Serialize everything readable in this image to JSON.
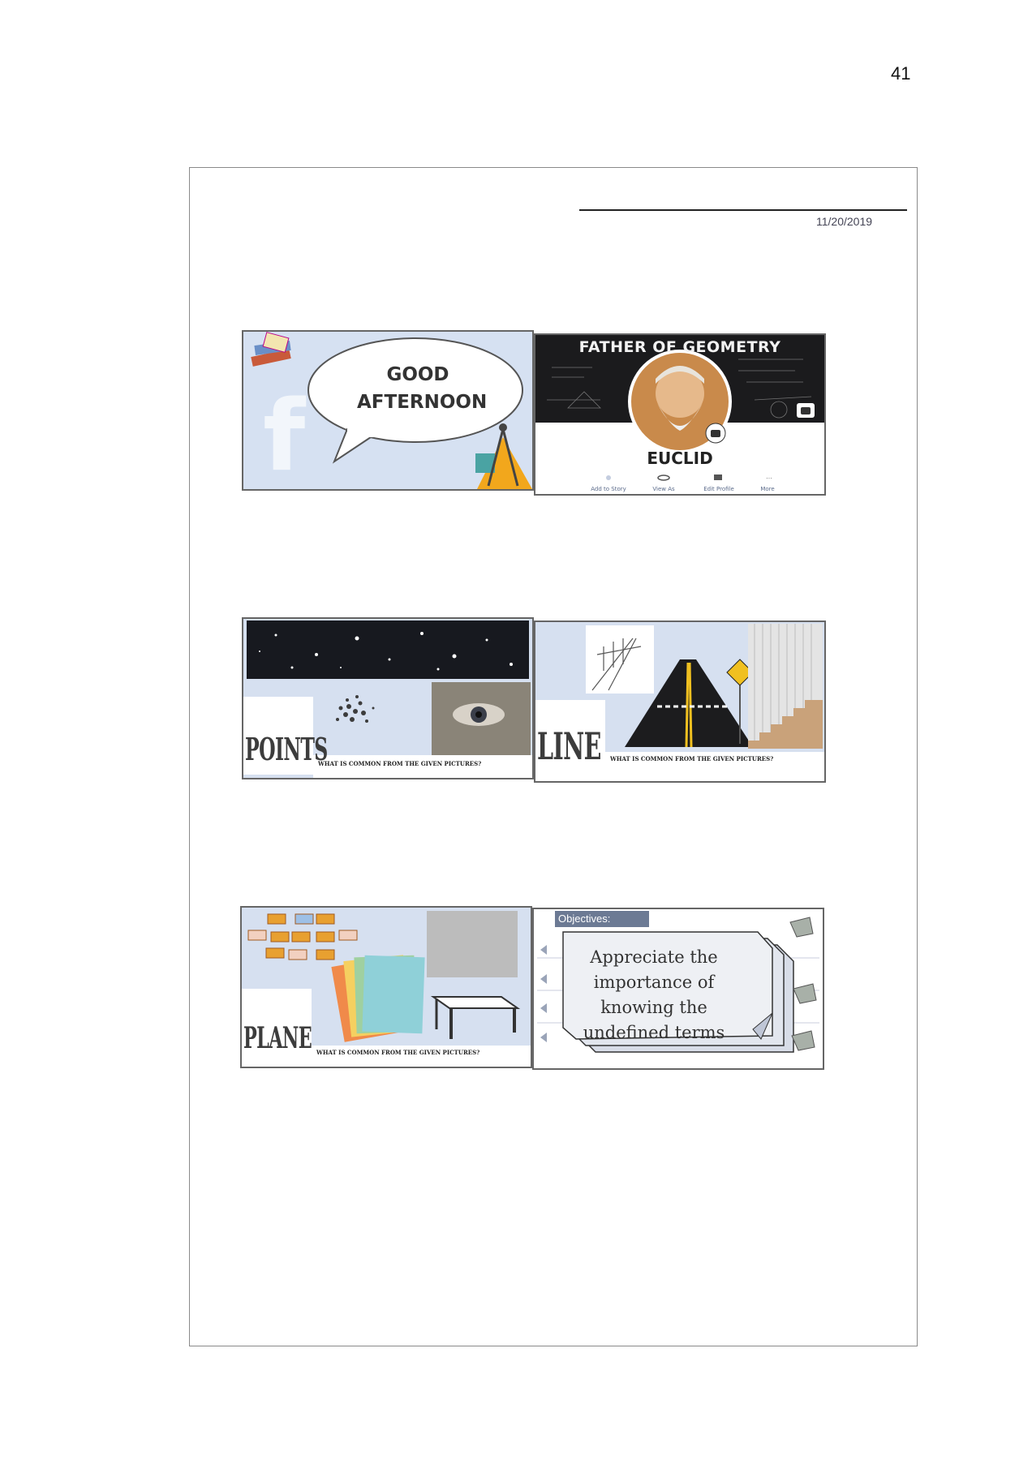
{
  "page_number": "41",
  "sheet": {
    "date": "11/20/2019"
  },
  "slides": {
    "greeting": {
      "line1": "GOOD",
      "line2": "AFTERNOON"
    },
    "euclid": {
      "banner": "FATHER OF GEOMETRY",
      "name": "EUCLID",
      "actions": [
        "Add to Story",
        "View As",
        "Edit Profile",
        "More"
      ]
    },
    "points": {
      "term": "POINTS",
      "question": "WHAT IS COMMON FROM THE GIVEN PICTURES?"
    },
    "line": {
      "term": "LINE",
      "question": "WHAT IS COMMON FROM THE GIVEN PICTURES?"
    },
    "plane": {
      "term": "PLANE",
      "question": "WHAT IS COMMON FROM THE GIVEN PICTURES?"
    },
    "objectives": {
      "tag": "Objectives:",
      "lines": [
        "Appreciate the",
        "importance of",
        "knowing the",
        "undefined terms"
      ]
    }
  },
  "colors": {
    "slide_bg": "#e9eef7",
    "night_sky": "#1a1c22",
    "objective_tag": "#6c7a94"
  }
}
